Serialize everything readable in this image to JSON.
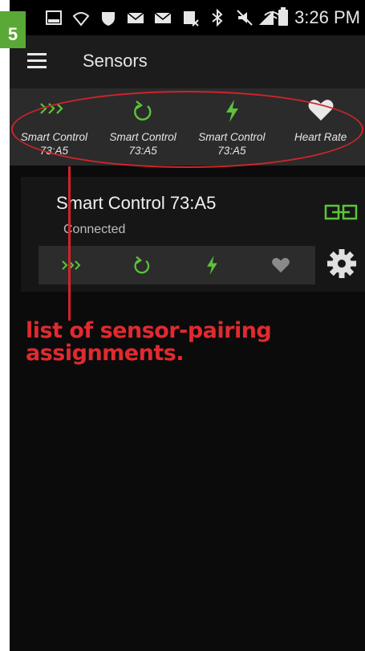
{
  "step": {
    "number": "5"
  },
  "status_bar": {
    "time": "3:26 PM"
  },
  "app_bar": {
    "title": "Sensors"
  },
  "sensor_strip": {
    "items": [
      {
        "icon": "speed-arrows-icon",
        "label_line1": "Smart Control",
        "label_line2": "73:A5"
      },
      {
        "icon": "refresh-cadence-icon",
        "label_line1": "Smart Control",
        "label_line2": "73:A5"
      },
      {
        "icon": "lightning-power-icon",
        "label_line1": "Smart Control",
        "label_line2": "73:A5"
      },
      {
        "icon": "heart-icon",
        "label_line1": "Heart Rate",
        "label_line2": ""
      }
    ]
  },
  "sensor_card": {
    "name": "Smart Control 73:A5",
    "status": "Connected",
    "icons": [
      "speed-arrows-icon",
      "refresh-cadence-icon",
      "lightning-power-icon",
      "heart-icon"
    ]
  },
  "annotation": {
    "text_line1": "list of sensor-pairing",
    "text_line2": "assignments."
  },
  "colors": {
    "accent_green": "#5cc43a",
    "annotation_red": "#d0242b",
    "inactive_gray": "#8a8a8a"
  }
}
